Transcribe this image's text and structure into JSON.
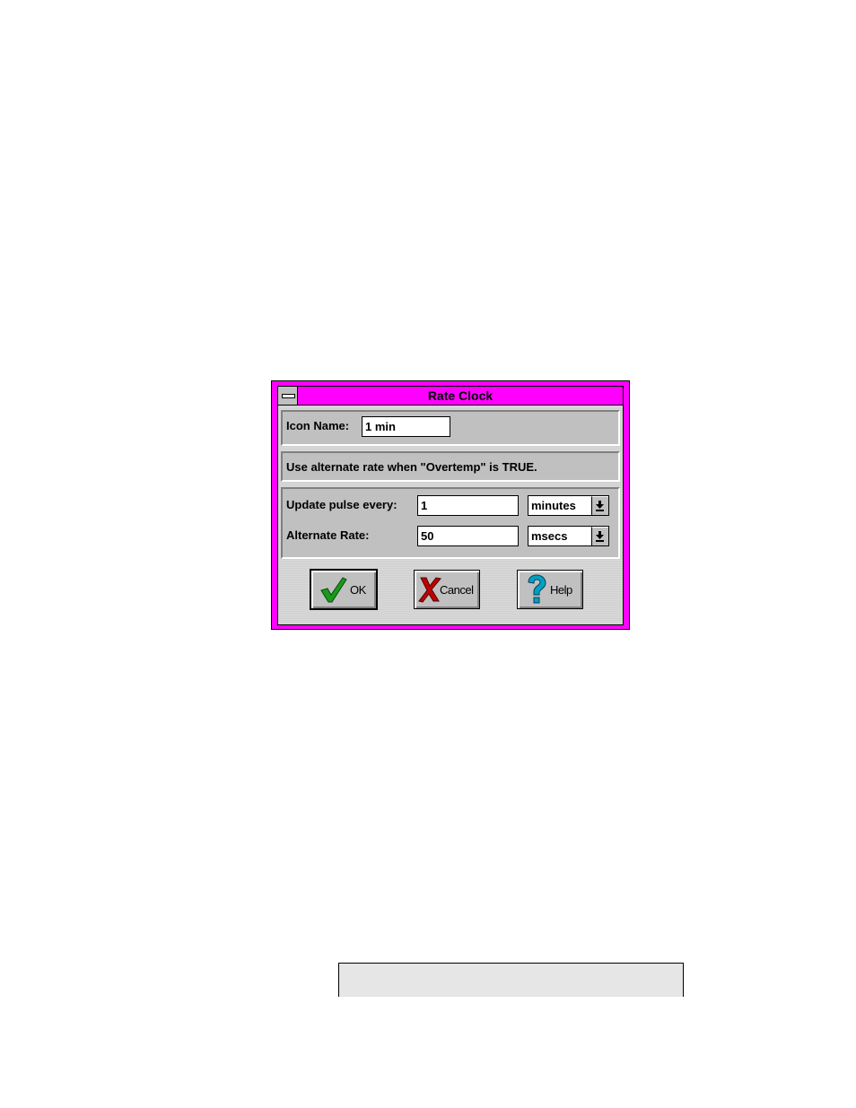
{
  "dialog": {
    "title": "Rate Clock",
    "icon_name_label": "Icon Name:",
    "icon_name_value": "1 min",
    "message": "Use alternate rate when \"Overtemp\" is TRUE.",
    "update_label": "Update pulse every:",
    "update_value": "1",
    "update_unit": "minutes",
    "alternate_label": "Alternate Rate:",
    "alternate_value": "50",
    "alternate_unit": "msecs",
    "ok_label": "OK",
    "cancel_label": "Cancel",
    "help_label": "Help"
  },
  "colors": {
    "frame": "#ff00ff",
    "face": "#c0c0c0",
    "ok_check": "#1a9a1a",
    "cancel_x": "#c00000",
    "help_q": "#00a0c0"
  },
  "icons": [
    "system-menu-icon",
    "dropdown-arrow-icon",
    "checkmark-icon",
    "x-icon",
    "question-mark-icon"
  ]
}
